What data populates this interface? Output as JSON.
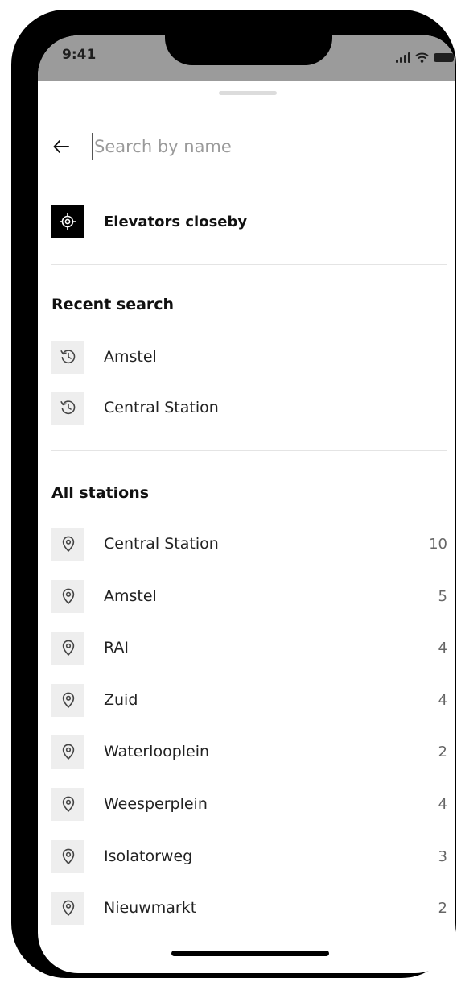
{
  "status_bar": {
    "time": "9:41"
  },
  "search": {
    "placeholder": "Search by name",
    "value": ""
  },
  "nearby": {
    "label": "Elevators closeby",
    "icon": "crosshair-icon"
  },
  "recent": {
    "title": "Recent search",
    "icon": "history-icon",
    "items": [
      {
        "label": "Amstel"
      },
      {
        "label": "Central Station"
      }
    ]
  },
  "stations": {
    "title": "All stations",
    "icon": "location-pin-icon",
    "items": [
      {
        "label": "Central Station",
        "count": "10"
      },
      {
        "label": "Amstel",
        "count": "5"
      },
      {
        "label": "RAI",
        "count": "4"
      },
      {
        "label": "Zuid",
        "count": "4"
      },
      {
        "label": "Waterlooplein",
        "count": "2"
      },
      {
        "label": "Weesperplein",
        "count": "4"
      },
      {
        "label": "Isolatorweg",
        "count": "3"
      },
      {
        "label": "Nieuwmarkt",
        "count": "2"
      }
    ]
  },
  "colors": {
    "status_bar_bg": "#9b9b9b",
    "icon_box_bg": "#eeeeee",
    "accent": "#000000"
  }
}
